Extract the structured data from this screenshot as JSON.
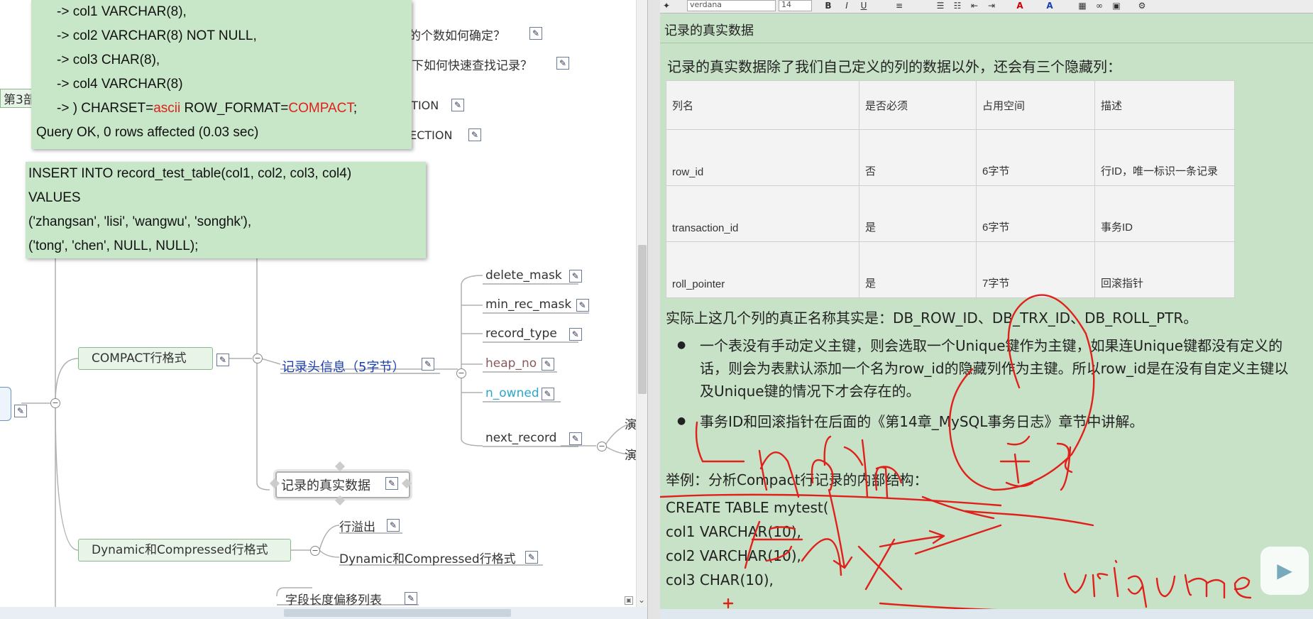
{
  "mindmap": {
    "partial_top_q1": "的个数如何确定？",
    "partial_top_q2": "下如何快速查找记录？",
    "partial_ction1": "CTION",
    "partial_rection": "RECTION",
    "partial_chapter": "第3部",
    "compact_node": "COMPACT行格式",
    "record_header_node": "记录头信息（5字节）",
    "real_data_node": "记录的真实数据",
    "dynamic_node": "Dynamic和Compressed行格式",
    "overflow_node": "行溢出",
    "dynamic_child": "Dynamic和Compressed行格式",
    "field_len_node": "字段长度偏移列表",
    "header_fields": [
      {
        "label": "delete_mask",
        "color": "#333333"
      },
      {
        "label": "min_rec_mask",
        "color": "#333333"
      },
      {
        "label": "record_type",
        "color": "#333333"
      },
      {
        "label": "heap_no",
        "color": "#8b5a5a"
      },
      {
        "label": "n_owned",
        "color": "#2aa7c9"
      },
      {
        "label": "next_record",
        "color": "#333333"
      }
    ],
    "edge_text_1": "演",
    "edge_text_2": "演"
  },
  "sql_popup_1": {
    "lines": [
      "->     col1 VARCHAR(8),",
      "->     col2 VARCHAR(8) NOT NULL,",
      "->     col3 CHAR(8),",
      "->     col4 VARCHAR(8)"
    ],
    "charset_prefix": "-> ) CHARSET=",
    "charset_value": "ascii",
    "row_format_prefix": " ROW_FORMAT=",
    "row_format_value": "COMPACT",
    "charset_suffix": ";",
    "result": "Query OK, 0 rows affected (0.03 sec)"
  },
  "sql_popup_2": {
    "lines": [
      "INSERT INTO record_test_table(col1, col2, col3, col4)",
      "VALUES",
      "('zhangsan', 'lisi', 'wangwu', 'songhk'),",
      "('tong', 'chen', NULL, NULL);"
    ]
  },
  "toolbar": {
    "font_name": "verdana",
    "font_size": "14"
  },
  "note": {
    "title": "记录的真实数据",
    "intro": "记录的真实数据除了我们自己定义的列的数据以外，还会有三个隐藏列：",
    "table_headers": [
      "列名",
      "是否必须",
      "占用空间",
      "描述"
    ],
    "table_rows": [
      [
        "row_id",
        "否",
        "6字节",
        "行ID，唯一标识一条记录"
      ],
      [
        "transaction_id",
        "是",
        "6字节",
        "事务ID"
      ],
      [
        "roll_pointer",
        "是",
        "7字节",
        "回滚指针"
      ]
    ],
    "real_names": "实际上这几个列的真正名称其实是：DB_ROW_ID、DB_TRX_ID、DB_ROLL_PTR。",
    "bullet1": "一个表没有手动定义主键，则会选取一个Unique键作为主键，如果连Unique键都没有定义的话，则会为表默认添加一个名为row_id的隐藏列作为主键。所以row_id是在没有自定义主键以及Unique键的情况下才会存在的。",
    "bullet2": "事务ID和回滚指针在后面的《第14章_MySQL事务日志》章节中讲解。",
    "example_title": "举例：分析Compact行记录的内部结构：",
    "code_lines": [
      "CREATE TABLE mytest(",
      "col1 VARCHAR(10),",
      "col2 VARCHAR(10),",
      "col3 CHAR(10),"
    ]
  },
  "colors": {
    "accent_red": "#e0201a",
    "popup_green": "#c8e6c8",
    "note_bg": "#c8e2c8",
    "link_blue": "#1a3fb0"
  }
}
